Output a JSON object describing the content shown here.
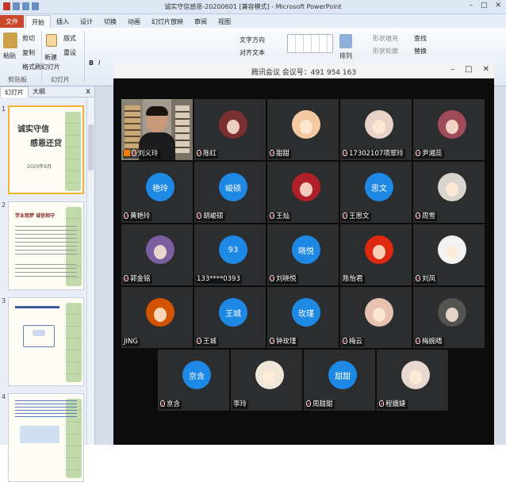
{
  "window": {
    "title": "诚实守信感恩-20200601 [兼容模式] - Microsoft PowerPoint",
    "controls": [
      "–",
      "□",
      "✕"
    ]
  },
  "ribbon_tabs": [
    "文件",
    "开始",
    "插入",
    "设计",
    "切换",
    "动画",
    "幻灯片放映",
    "审阅",
    "视图"
  ],
  "ribbon": {
    "paste": "粘贴",
    "cut": "剪切",
    "copy": "复制",
    "format_painter": "格式刷",
    "clipboard_group": "剪贴板",
    "new_slide": "新建",
    "new_slide2": "幻灯片",
    "slides_group": "幻灯片",
    "layout": "版式",
    "reset": "重设",
    "text_direction": "文字方向",
    "align_text": "对齐文本",
    "shape_fill": "形状填充",
    "shape_outline": "形状轮廓",
    "find": "查找",
    "replace": "替换",
    "arrange": "排列"
  },
  "pane": {
    "tab_slides": "幻灯片",
    "tab_outline": "大纲",
    "close": "x"
  },
  "thumbnails": [
    {
      "num": "1",
      "title1": "诚实守信",
      "title2": "感恩还贷",
      "date": "2020年6月"
    },
    {
      "num": "2",
      "title1": "学业观梦 诚信相守"
    },
    {
      "num": "3"
    },
    {
      "num": "4"
    }
  ],
  "meeting": {
    "title": "腾讯会议 会议号：491 954 163",
    "controls": [
      "–",
      "□",
      "✕"
    ]
  },
  "participants": [
    {
      "name": "刘义玲",
      "type": "video",
      "host": true
    },
    {
      "name": "陈红",
      "type": "photo",
      "color": "#7a3030"
    },
    {
      "name": "甜甜",
      "type": "photo",
      "color": "#f4c9a0"
    },
    {
      "name": "17302107项翠玲",
      "type": "photo",
      "color": "#e9d3c7"
    },
    {
      "name": "尹湘蕊",
      "type": "photo",
      "color": "#a04b5a"
    },
    {
      "name": "黄艳玲",
      "type": "text",
      "avatar": "艳玲"
    },
    {
      "name": "胡峻硕",
      "type": "text",
      "avatar": "峻硕"
    },
    {
      "name": "王灿",
      "type": "photo",
      "color": "#b0202a"
    },
    {
      "name": "王思文",
      "type": "text",
      "avatar": "思文"
    },
    {
      "name": "周雪",
      "type": "photo",
      "color": "#d9d4cc"
    },
    {
      "name": "郭金铭",
      "type": "photo",
      "color": "#7b5fa0"
    },
    {
      "name": "133****0393",
      "type": "text",
      "avatar": "93",
      "muted": false
    },
    {
      "name": "刘晓悦",
      "type": "text",
      "avatar": "晓悦"
    },
    {
      "name": "陈怡君",
      "type": "photo",
      "color": "#de2910",
      "muted": false
    },
    {
      "name": "刘凤",
      "type": "photo",
      "color": "#f2f2f2"
    },
    {
      "name": "JING",
      "type": "photo",
      "color": "#d35400",
      "muted": false
    },
    {
      "name": "王城",
      "type": "text",
      "avatar": "王城"
    },
    {
      "name": "钟玫瑾",
      "type": "text",
      "avatar": "玫瑾"
    },
    {
      "name": "梅云",
      "type": "photo",
      "color": "#e8c2b0"
    },
    {
      "name": "梅婉晴",
      "type": "photo",
      "color": "#54534f"
    },
    {
      "name": "京含",
      "type": "text",
      "avatar": "京含"
    },
    {
      "name": "李玲",
      "type": "photo",
      "color": "#efe6d8",
      "muted": false
    },
    {
      "name": "周甜甜",
      "type": "text",
      "avatar": "甜甜"
    },
    {
      "name": "程娥婕",
      "type": "photo",
      "color": "#e7d9cf"
    }
  ],
  "colors": {
    "accent_blue": "#1e88e5",
    "meeting_bg": "#0c0c0c",
    "tile_bg": "#2c2d2f",
    "file_tab": "#c9472b",
    "selected_slide": "#f1b330"
  }
}
